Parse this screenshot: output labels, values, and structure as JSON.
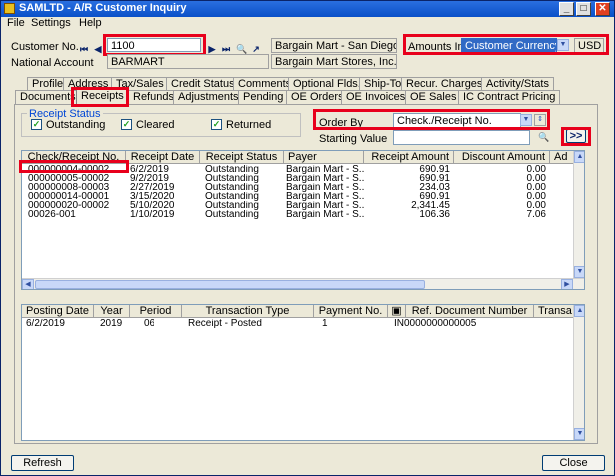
{
  "window": {
    "title": "SAMLTD - A/R Customer Inquiry"
  },
  "menu": [
    "File",
    "Settings",
    "Help"
  ],
  "customer": {
    "label": "Customer No.",
    "value": "1100",
    "name": "Bargain Mart - San Diego"
  },
  "amounts": {
    "label": "Amounts In",
    "value": "Customer Currency",
    "currency": "USD"
  },
  "national": {
    "label": "National Account",
    "value": "BARMART",
    "name": "Bargain Mart Stores, Inc."
  },
  "tabs_row1": [
    "Profile",
    "Address",
    "Tax/Sales",
    "Credit Status",
    "Comments",
    "Optional Flds.",
    "Ship-To",
    "Recur. Charges",
    "Activity/Stats"
  ],
  "tabs_row2": [
    "Documents",
    "Receipts",
    "Refunds",
    "Adjustments",
    "Pending",
    "OE Orders",
    "OE Invoices",
    "OE Sales",
    "IC Contract Pricing"
  ],
  "receipt_status": {
    "label": "Receipt Status",
    "outstanding": "Outstanding",
    "cleared": "Cleared",
    "returned": "Returned"
  },
  "order_by": {
    "label": "Order By",
    "value": "Check./Receipt No."
  },
  "starting_value": {
    "label": "Starting Value",
    "value": ""
  },
  "go_button": ">>",
  "receipts_grid": {
    "headers": [
      "Check/Receipt No.",
      "Receipt Date",
      "Receipt Status",
      "Payer",
      "Receipt Amount",
      "Discount Amount",
      "Ad"
    ],
    "rows": [
      [
        "000000004-00002",
        "6/2/2019",
        "Outstanding",
        "Bargain Mart - S...",
        "690.91",
        "0.00"
      ],
      [
        "000000005-00002",
        "9/2/2019",
        "Outstanding",
        "Bargain Mart - S...",
        "690.91",
        "0.00"
      ],
      [
        "000000008-00003",
        "2/27/2019",
        "Outstanding",
        "Bargain Mart - S...",
        "234.03",
        "0.00"
      ],
      [
        "000000014-00001",
        "3/15/2020",
        "Outstanding",
        "Bargain Mart - S...",
        "690.91",
        "0.00"
      ],
      [
        "000000020-00002",
        "5/10/2020",
        "Outstanding",
        "Bargain Mart - S...",
        "2,341.45",
        "0.00"
      ],
      [
        "00026-001",
        "1/10/2019",
        "Outstanding",
        "Bargain Mart - S...",
        "106.36",
        "7.06"
      ]
    ]
  },
  "trans_grid": {
    "headers": [
      "Posting Date",
      "Year",
      "Period",
      "Transaction Type",
      "Payment No.",
      "",
      "Ref. Document Number",
      "Transa"
    ],
    "rows": [
      [
        "6/2/2019",
        "2019",
        "06",
        "Receipt - Posted",
        "1",
        "",
        "IN0000000000005",
        ""
      ]
    ]
  },
  "buttons": {
    "refresh": "Refresh",
    "close": "Close"
  }
}
